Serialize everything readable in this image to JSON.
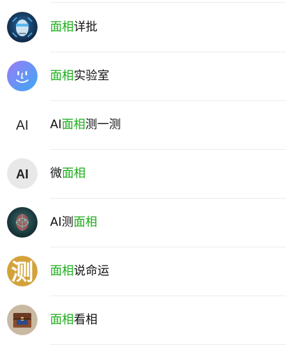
{
  "colors": {
    "highlight": "#1aad19",
    "text": "#111111",
    "divider": "#ececec"
  },
  "results": [
    {
      "icon": "robot-face-icon",
      "before": "",
      "keyword": "面相",
      "after": "详批"
    },
    {
      "icon": "smiley-face-icon",
      "before": "",
      "keyword": "面相",
      "after": "实验室"
    },
    {
      "icon": "ai-text-icon",
      "avatar_text": "AI",
      "before": "AI",
      "keyword": "面相",
      "after": "测一测"
    },
    {
      "icon": "ai-circle-icon",
      "avatar_text": "AI",
      "before": "微",
      "keyword": "面相",
      "after": ""
    },
    {
      "icon": "scan-face-icon",
      "before": "AI测",
      "keyword": "面相",
      "after": ""
    },
    {
      "icon": "ce-character-icon",
      "avatar_text": "测",
      "before": "",
      "keyword": "面相",
      "after": "说命运"
    },
    {
      "icon": "treasure-chest-icon",
      "before": "",
      "keyword": "面相",
      "after": "看相"
    }
  ]
}
